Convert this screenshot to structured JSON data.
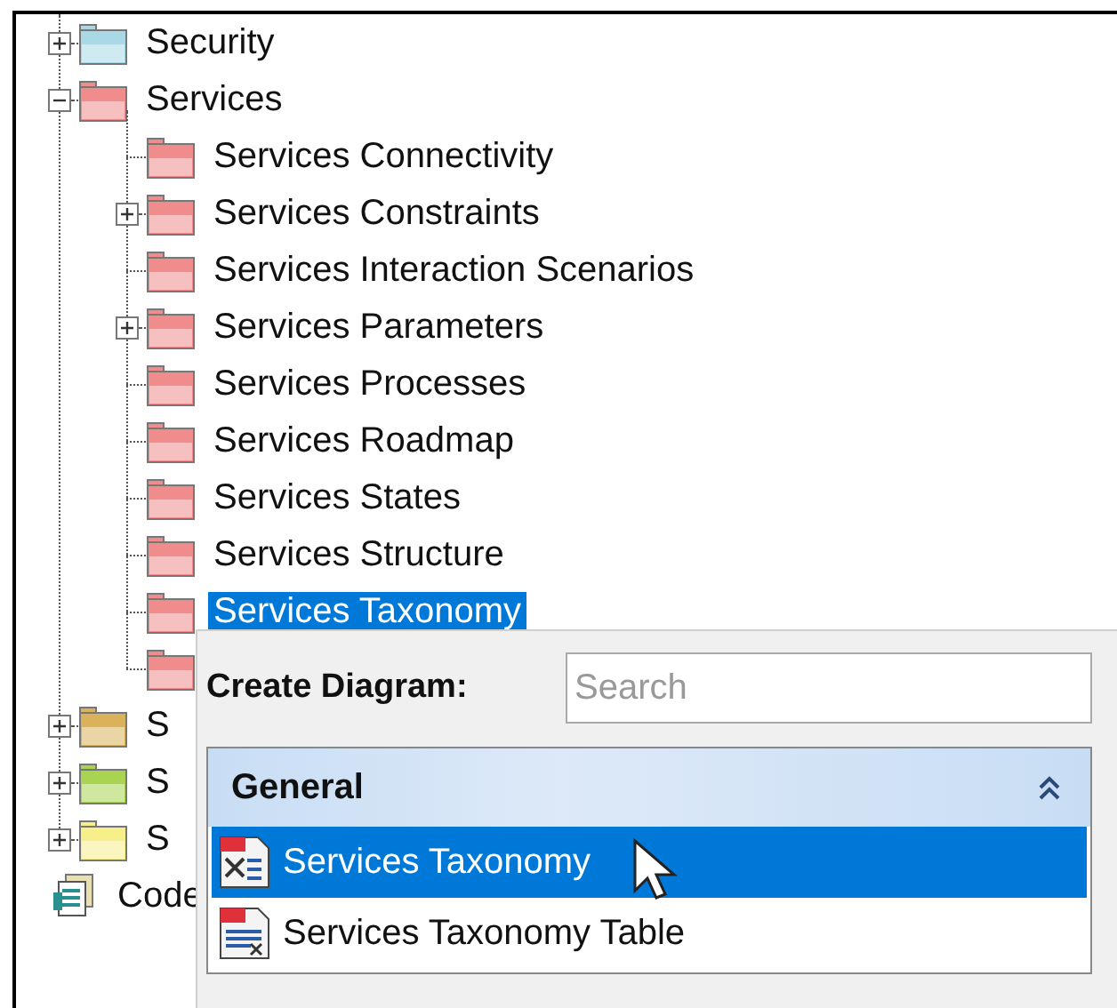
{
  "tree": [
    {
      "label": "Security",
      "kind": "folder",
      "color": "#a9d9e6",
      "expanded": false,
      "selected": false
    },
    {
      "label": "Services",
      "kind": "folder",
      "color": "#f08c8c",
      "expanded": true,
      "selected": false,
      "children": [
        {
          "label": "Services Connectivity",
          "kind": "folder",
          "color": "#f08c8c",
          "selected": false
        },
        {
          "label": "Services Constraints",
          "kind": "folder",
          "color": "#f08c8c",
          "expanded": false,
          "selected": false
        },
        {
          "label": "Services Interaction Scenarios",
          "kind": "folder",
          "color": "#f08c8c",
          "selected": false
        },
        {
          "label": "Services Parameters",
          "kind": "folder",
          "color": "#f08c8c",
          "expanded": false,
          "selected": false
        },
        {
          "label": "Services Processes",
          "kind": "folder",
          "color": "#f08c8c",
          "selected": false
        },
        {
          "label": "Services Roadmap",
          "kind": "folder",
          "color": "#f08c8c",
          "selected": false
        },
        {
          "label": "Services States",
          "kind": "folder",
          "color": "#f08c8c",
          "selected": false
        },
        {
          "label": "Services Structure",
          "kind": "folder",
          "color": "#f08c8c",
          "selected": false
        },
        {
          "label": "Services Taxonomy",
          "kind": "folder",
          "color": "#f08c8c",
          "selected": true
        },
        {
          "kind": "folder",
          "color": "#f08c8c",
          "selected": false
        }
      ]
    },
    {
      "label": "S",
      "kind": "folder",
      "color": "#d9b25a",
      "expanded": false,
      "selected": false
    },
    {
      "label": "S",
      "kind": "folder",
      "color": "#a9d452",
      "expanded": false,
      "selected": false
    },
    {
      "label": "S",
      "kind": "folder",
      "color": "#f7ef8a",
      "expanded": false,
      "selected": false
    },
    {
      "label": "Code",
      "kind": "code",
      "selected": false
    }
  ],
  "popup": {
    "title": "Create Diagram:",
    "search": {
      "placeholder": "Search"
    },
    "groups": [
      {
        "title": "General",
        "expanded": true,
        "items": [
          {
            "label": "Services Taxonomy",
            "kind": "taxonomy",
            "selected": true
          },
          {
            "label": "Services Taxonomy Table",
            "kind": "table",
            "selected": false
          }
        ]
      }
    ]
  }
}
